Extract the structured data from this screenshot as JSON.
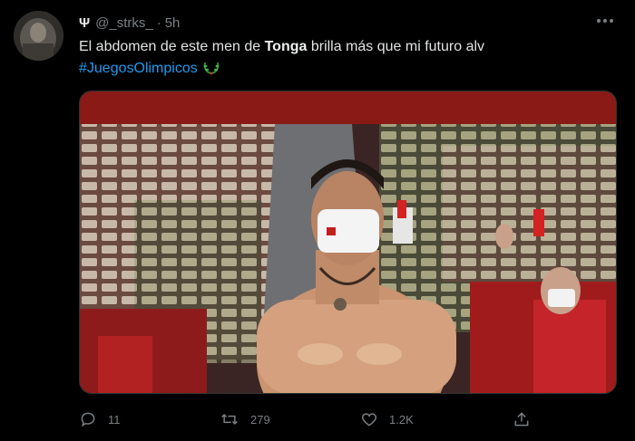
{
  "tweet": {
    "author_name": "Ψ",
    "handle": "@_strks_",
    "separator": "·",
    "time": "5h",
    "text_before": "El abdomen de este men de ",
    "text_bold": "Tonga",
    "text_after": " brilla más que mi futuro alv",
    "hashtag": "#JuegosOlimpicos",
    "hashtag_emoji": "laurel-wreath-icon"
  },
  "actions": {
    "replies": "11",
    "retweets": "279",
    "likes": "1.2K"
  },
  "colors": {
    "background": "#000000",
    "link": "#1d9bf0",
    "muted": "#7a7f84",
    "text": "#e1e3e4"
  }
}
